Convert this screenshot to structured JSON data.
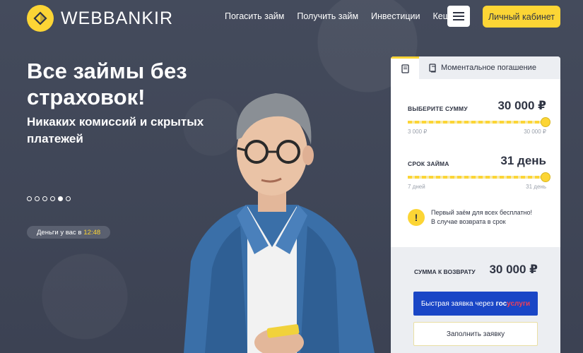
{
  "brand": {
    "name": "WEBBANKIR",
    "logo_icon": "diamond-icon",
    "accent": "#fcd535"
  },
  "nav": {
    "items": [
      "Погасить займ",
      "Получить займ",
      "Инвестиции",
      "Кешбэк"
    ],
    "menu_icon": "hamburger-icon",
    "cabinet_label": "Личный кабинет"
  },
  "hero": {
    "title": "Все займы без страховок!",
    "subtitle": "Никаких комиссий и скрытых платежей",
    "slides": {
      "count": 6,
      "active": 4
    },
    "money_label": "Деньги у вас в",
    "money_time": "12:48"
  },
  "card": {
    "tabs": {
      "first_icon": "document-icon",
      "instant_icon": "receipt-icon",
      "instant_label": "Моментальное погашение"
    },
    "amount": {
      "label": "Выберите сумму",
      "value": "30 000 ₽",
      "min": "3 000 ₽",
      "max": "30 000 ₽",
      "level": 1.0
    },
    "term": {
      "label": "Срок займа",
      "value": "31 день",
      "min": "7 дней",
      "max": "31 день",
      "level": 1.0
    },
    "notice": {
      "icon": "exclamation-icon",
      "line1": "Первый заём для всех бесплатно!",
      "line2": "В случае возврата в срок"
    },
    "return": {
      "label": "Сумма к возврату",
      "value": "30 000 ₽"
    },
    "gos_button": {
      "prefix": "Быстрая заявка через",
      "gos": "гос",
      "uslugi": "услуги"
    },
    "fill_button": "Заполнить заявку"
  }
}
